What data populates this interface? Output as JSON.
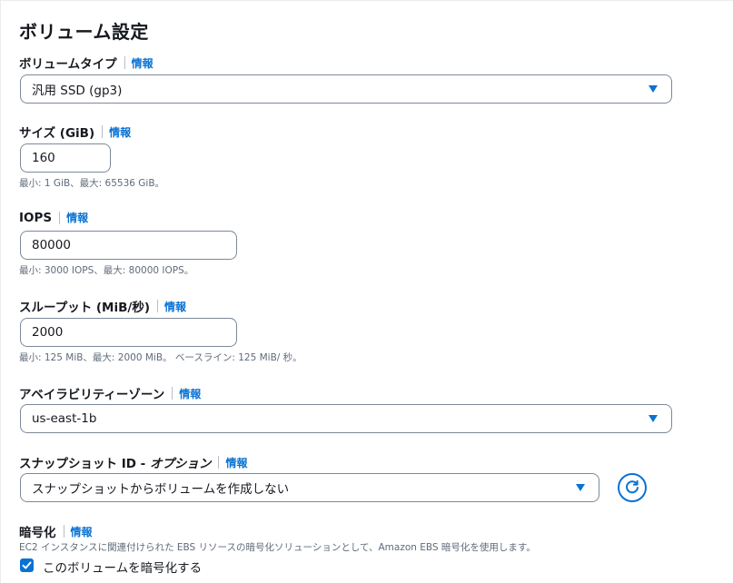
{
  "section": {
    "title": "ボリューム設定"
  },
  "info_link": "情報",
  "volume_type": {
    "label": "ボリュームタイプ",
    "value": "汎用 SSD (gp3)"
  },
  "size": {
    "label": "サイズ (GiB)",
    "value": "160",
    "hint": "最小: 1 GiB、最大: 65536 GiB。"
  },
  "iops": {
    "label": "IOPS",
    "value": "80000",
    "hint": "最小: 3000 IOPS、最大: 80000 IOPS。"
  },
  "throughput": {
    "label": "スループット (MiB/秒)",
    "value": "2000",
    "hint": "最小: 125 MiB、最大: 2000 MiB。 ベースライン: 125 MiB/ 秒。"
  },
  "availability_zone": {
    "label": "アベイラビリティーゾーン",
    "value": "us-east-1b"
  },
  "snapshot": {
    "label": "スナップショット ID - ",
    "label_optional": "オプション",
    "value": "スナップショットからボリュームを作成しない",
    "refresh_icon": "refresh-icon"
  },
  "encryption": {
    "label": "暗号化",
    "description": "EC2 インスタンスに関連付けられた EBS リソースの暗号化ソリューションとして、Amazon EBS 暗号化を使用します。",
    "checkbox_label": "このボリュームを暗号化する",
    "checked": true
  },
  "colors": {
    "accent": "#0972d3",
    "text": "#16191f",
    "muted": "#5f6b7a",
    "border": "#7d8998"
  }
}
